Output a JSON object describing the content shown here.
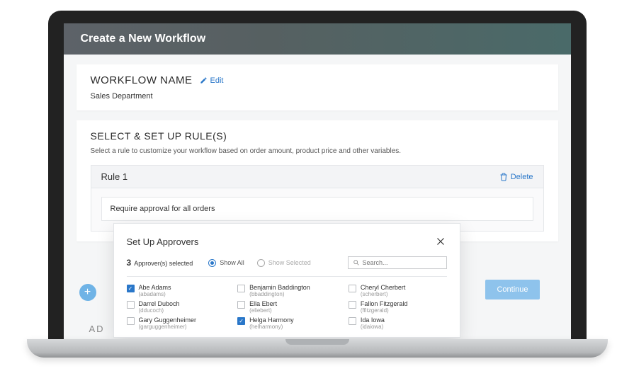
{
  "header": {
    "title": "Create a New Workflow"
  },
  "workflow": {
    "label": "WORKFLOW NAME",
    "edit": "Edit",
    "name": "Sales Department"
  },
  "rules": {
    "title": "SELECT & SET UP RULE(S)",
    "desc": "Select a rule to customize your workflow based on order amount, product price and other variables.",
    "rule1": {
      "title": "Rule 1",
      "delete": "Delete",
      "body": "Require approval for all orders"
    }
  },
  "continue": "Continue",
  "bottomTab": "AD",
  "modal": {
    "title": "Set Up Approvers",
    "count": "3",
    "countLabel": "Approver(s) selected",
    "showAll": "Show All",
    "showSelected": "Show Selected",
    "searchPlaceholder": "Search...",
    "approvers": [
      {
        "name": "Abe Adams",
        "sub": "(abadams)",
        "checked": true
      },
      {
        "name": "Benjamin Baddington",
        "sub": "(bbaddington)",
        "checked": false
      },
      {
        "name": "Cheryl Cherbert",
        "sub": "(scherbert)",
        "checked": false
      },
      {
        "name": "Darrel Duboch",
        "sub": "(dducoch)",
        "checked": false
      },
      {
        "name": "Ella Ebert",
        "sub": "(eliebert)",
        "checked": false
      },
      {
        "name": "Fallon Fitzgerald",
        "sub": "(ffitzgerald)",
        "checked": false
      },
      {
        "name": "Gary Guggenheimer",
        "sub": "(garguggenheimer)",
        "checked": false
      },
      {
        "name": "Helga Harmony",
        "sub": "(helharmony)",
        "checked": true
      },
      {
        "name": "Ida Iowa",
        "sub": "(idaiowa)",
        "checked": false
      }
    ]
  }
}
